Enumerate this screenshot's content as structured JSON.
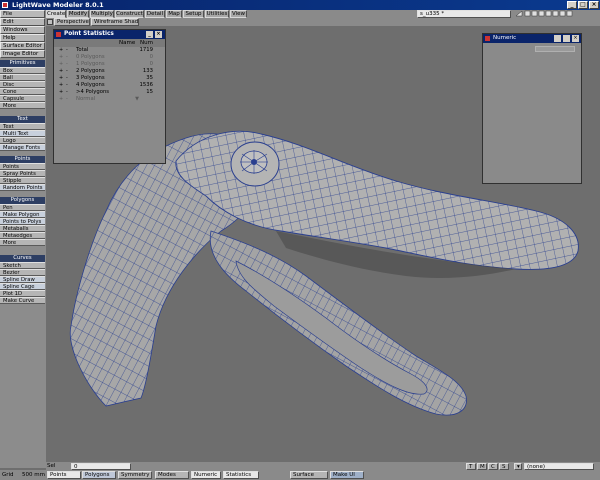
{
  "window": {
    "title": "LightWave Modeler 8.0.1",
    "buttons": [
      "_",
      "□",
      "×"
    ]
  },
  "top_left_menu": [
    "File",
    "Edit",
    "Windows",
    "Help",
    "Surface Editor",
    "Image Editor"
  ],
  "tabs": [
    {
      "label": "Create",
      "active": true
    },
    {
      "label": "Modify",
      "active": false
    },
    {
      "label": "Multiply",
      "active": false
    },
    {
      "label": "Construct",
      "active": false
    },
    {
      "label": "Detail",
      "active": false
    },
    {
      "label": "Map",
      "active": false
    },
    {
      "label": "Setup",
      "active": false
    },
    {
      "label": "Utilities",
      "active": false
    },
    {
      "label": "View",
      "active": false
    }
  ],
  "layer_field": "s_u335 *",
  "viewport": {
    "view": "Perspective",
    "shading": "Wireframe Shade"
  },
  "toolsections": [
    {
      "header": "Primitives",
      "items": [
        "Box",
        "Ball",
        "Disc",
        "Cone",
        "Capsule",
        "More"
      ]
    },
    {
      "header": "Text",
      "items": [
        "Text",
        "Multi Text",
        "Logo",
        "Manage Fonts"
      ]
    },
    {
      "header": "Points",
      "items": [
        "Points",
        "Spray Points",
        "Stipple",
        "Random Points"
      ]
    },
    {
      "header": "Polygons",
      "items": [
        "Pen",
        "Make Polygon",
        "Points to Polys",
        "Metaballs",
        "Metaedges",
        "More"
      ]
    },
    {
      "header": "Curves",
      "items": [
        "Sketch",
        "Bezier",
        "Spline Draw",
        "Spline Cage",
        "Plot 1D",
        "Make Curve"
      ]
    }
  ],
  "point_stats": {
    "title": "Point Statistics",
    "col_name": "Name",
    "col_num": "Num",
    "rows": [
      {
        "label": "Total",
        "value": "1719",
        "dim": false
      },
      {
        "label": "0 Polygons",
        "value": "0",
        "dim": true
      },
      {
        "label": "1 Polygons",
        "value": "0",
        "dim": true
      },
      {
        "label": "2 Polygons",
        "value": "133",
        "dim": false
      },
      {
        "label": "3 Polygons",
        "value": "35",
        "dim": false
      },
      {
        "label": "4 Polygons",
        "value": "1536",
        "dim": false
      },
      {
        "label": ">4 Polygons",
        "value": "15",
        "dim": false
      },
      {
        "label": "Normal",
        "value": "",
        "dim": true
      }
    ]
  },
  "numeric_panel": {
    "title": "Numeric"
  },
  "status_row1": {
    "sel_label": "Sel",
    "sel_value": "0",
    "view_modes": [
      "T",
      "M",
      "C",
      "S"
    ],
    "layer_select": "(none)"
  },
  "status_row2": {
    "grid_label": "Grid",
    "grid_value": "500 mm",
    "points": "Points",
    "polygons": "Polygons",
    "symmetry": "Symmetry",
    "modes": "Modes",
    "numeric": "Numeric",
    "statistics": "Statistics",
    "surface": "Surface",
    "made": "Make UI"
  },
  "colors": {
    "titlebar": "#08246b",
    "mesh_surface": "#a9a9a9",
    "mesh_wire": "#2a3f8f",
    "background": "#6e6e6e"
  }
}
